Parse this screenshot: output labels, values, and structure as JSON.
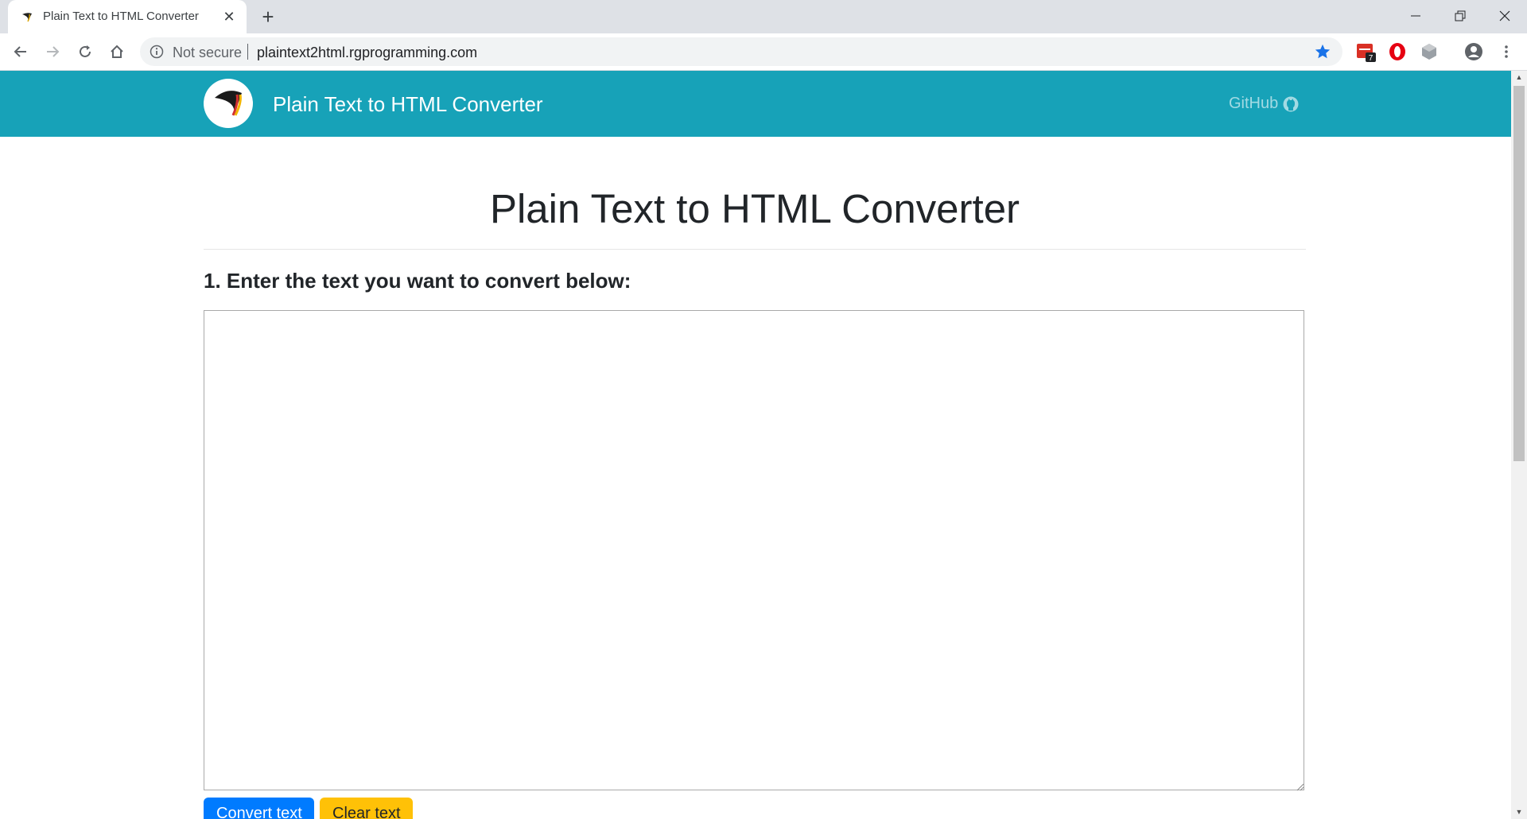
{
  "browser": {
    "tab_title": "Plain Text to HTML Converter",
    "security_label": "Not secure",
    "url": "plaintext2html.rgprogramming.com",
    "extension_badge": "7"
  },
  "navbar": {
    "brand": "Plain Text to HTML Converter",
    "github_label": "GitHub"
  },
  "main": {
    "heading": "Plain Text to HTML Converter",
    "step1_label": "1. Enter the text you want to convert below:",
    "textarea_value": "",
    "convert_label": "Convert text",
    "clear_label": "Clear text"
  },
  "colors": {
    "navbar": "#17a2b8",
    "primary": "#007bff",
    "warning": "#ffc107"
  }
}
